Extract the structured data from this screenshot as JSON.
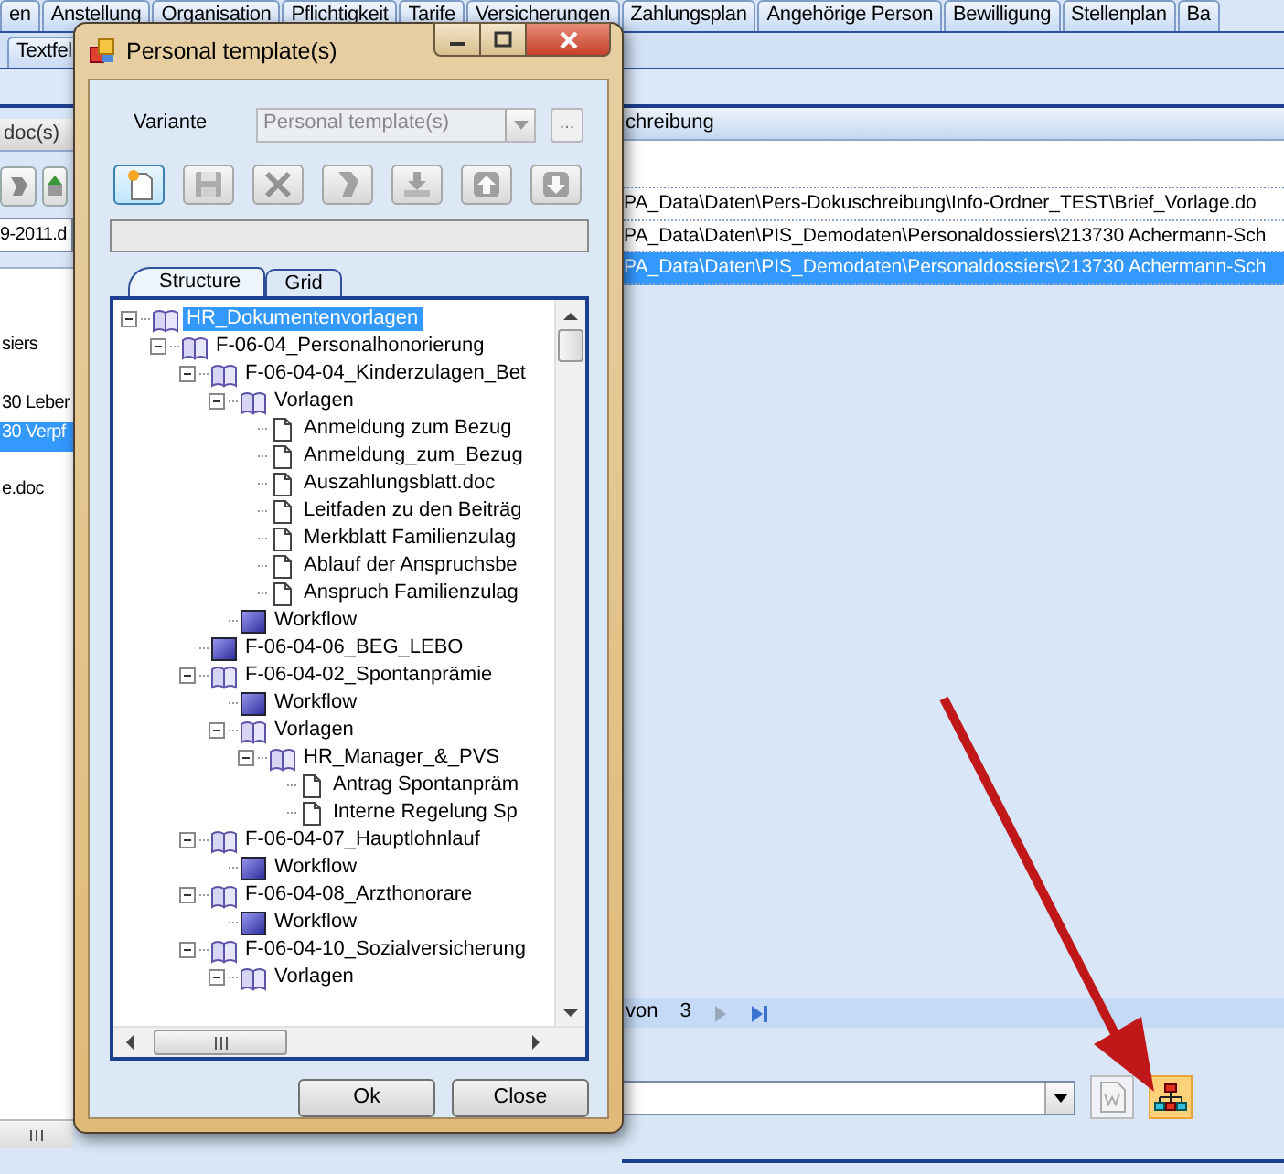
{
  "main_tabs": [
    {
      "label": "en",
      "selected": false
    },
    {
      "label": "Anstellung",
      "selected": false
    },
    {
      "label": "Organisation",
      "selected": false
    },
    {
      "label": "Pflichtigkeit",
      "selected": false
    },
    {
      "label": "Tarife",
      "selected": false
    },
    {
      "label": "Versicherungen",
      "selected": false
    },
    {
      "label": "Zahlungsplan",
      "selected": false
    },
    {
      "label": "Angehörige Person",
      "selected": false
    },
    {
      "label": "Bewilligung",
      "selected": false
    },
    {
      "label": "Stellenplan",
      "selected": false
    },
    {
      "label": "Ba",
      "selected": false
    }
  ],
  "sub_tab": {
    "label": "Textfel"
  },
  "left_panel": {
    "header": "doc(s)",
    "field_value": "9-2011.d",
    "items": [
      {
        "text": "siers",
        "selected": false
      },
      {
        "text": "30 Leber",
        "selected": false
      },
      {
        "text": "30 Verpf",
        "selected": true
      },
      {
        "text": "e.doc",
        "selected": false
      }
    ]
  },
  "list_panel": {
    "header": "chreibung",
    "rows": [
      {
        "path": "PA_Data\\Daten\\Pers-Dokuschreibung\\Info-Ordner_TEST\\Brief_Vorlage.do",
        "selected": false
      },
      {
        "path": "PA_Data\\Daten\\PIS_Demodaten\\Personaldossiers\\213730 Achermann-Sch",
        "selected": false
      },
      {
        "path": "PA_Data\\Daten\\PIS_Demodaten\\Personaldossiers\\213730 Achermann-Sch",
        "selected": true
      }
    ]
  },
  "pager": {
    "of_label": "von",
    "total": "3"
  },
  "bottom_buttons": [
    {
      "kind": "document",
      "disabled": true,
      "hovered": false
    },
    {
      "kind": "org_chart",
      "disabled": false,
      "hovered": true
    }
  ],
  "dialog": {
    "title": "Personal template(s)",
    "variante_label": "Variante",
    "variante_value": "Personal template(s)",
    "variante_disabled": true,
    "browse_button": "...",
    "toolbar": [
      {
        "kind": "new",
        "disabled": false
      },
      {
        "kind": "save",
        "disabled": true
      },
      {
        "kind": "delete",
        "disabled": true
      },
      {
        "kind": "edit",
        "disabled": true
      },
      {
        "kind": "import",
        "disabled": true
      },
      {
        "kind": "up",
        "disabled": true
      },
      {
        "kind": "down",
        "disabled": true
      }
    ],
    "tabs": [
      {
        "label": "Structure",
        "selected": true
      },
      {
        "label": "Grid",
        "selected": false
      }
    ],
    "tree": [
      {
        "label": "HR_Dokumentenvorlagen",
        "kind": "folder",
        "expanded": true,
        "selected": true,
        "children": [
          {
            "label": "F-06-04_Personalhonorierung",
            "kind": "folder",
            "expanded": true,
            "selected": false,
            "children": [
              {
                "label": "F-06-04-04_Kinderzulagen_Bet",
                "kind": "folder",
                "expanded": true,
                "selected": false,
                "children": [
                  {
                    "label": "Vorlagen",
                    "kind": "folder",
                    "expanded": true,
                    "selected": false,
                    "children": [
                      {
                        "label": "Anmeldung zum Bezug",
                        "kind": "document",
                        "selected": false
                      },
                      {
                        "label": "Anmeldung_zum_Bezug",
                        "kind": "document",
                        "selected": false
                      },
                      {
                        "label": "Auszahlungsblatt.doc",
                        "kind": "document",
                        "selected": false
                      },
                      {
                        "label": "Leitfaden zu den Beiträg",
                        "kind": "document",
                        "selected": false
                      },
                      {
                        "label": "Merkblatt Familienzulag",
                        "kind": "document",
                        "selected": false
                      },
                      {
                        "label": "Ablauf der Anspruchsbe",
                        "kind": "document",
                        "selected": false
                      },
                      {
                        "label": "Anspruch Familienzulag",
                        "kind": "document",
                        "selected": false
                      }
                    ]
                  },
                  {
                    "label": "Workflow",
                    "kind": "workflow",
                    "selected": false
                  }
                ]
              },
              {
                "label": "F-06-04-06_BEG_LEBO",
                "kind": "workflow",
                "selected": false
              },
              {
                "label": "F-06-04-02_Spontanprämie",
                "kind": "folder",
                "expanded": true,
                "selected": false,
                "children": [
                  {
                    "label": "Workflow",
                    "kind": "workflow",
                    "selected": false
                  },
                  {
                    "label": "Vorlagen",
                    "kind": "folder",
                    "expanded": true,
                    "selected": false,
                    "children": [
                      {
                        "label": "HR_Manager_&_PVS",
                        "kind": "folder",
                        "expanded": true,
                        "selected": false,
                        "children": [
                          {
                            "label": "Antrag Spontanpräm",
                            "kind": "document",
                            "selected": false
                          },
                          {
                            "label": "Interne Regelung Sp",
                            "kind": "document",
                            "selected": false
                          }
                        ]
                      }
                    ]
                  }
                ]
              },
              {
                "label": "F-06-04-07_Hauptlohnlauf",
                "kind": "folder",
                "expanded": true,
                "selected": false,
                "children": [
                  {
                    "label": "Workflow",
                    "kind": "workflow",
                    "selected": false
                  }
                ]
              },
              {
                "label": "F-06-04-08_Arzthonorare",
                "kind": "folder",
                "expanded": true,
                "selected": false,
                "children": [
                  {
                    "label": "Workflow",
                    "kind": "workflow",
                    "selected": false
                  }
                ]
              },
              {
                "label": "F-06-04-10_Sozialversicherung",
                "kind": "folder",
                "expanded": true,
                "selected": false,
                "children": [
                  {
                    "label": "Vorlagen",
                    "kind": "folder",
                    "expanded": true,
                    "selected": false
                  }
                ]
              }
            ]
          }
        ]
      }
    ],
    "buttons": [
      {
        "label": "Ok"
      },
      {
        "label": "Close"
      }
    ]
  }
}
